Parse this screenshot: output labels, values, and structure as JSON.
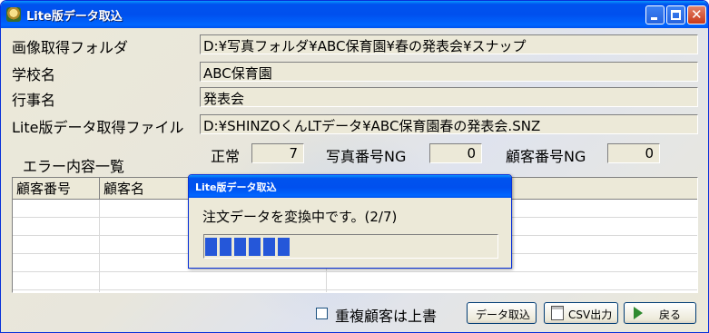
{
  "window": {
    "title": "Lite版データ取込",
    "controls": {
      "minimize": "minimize",
      "maximize": "maximize",
      "close": "✕"
    }
  },
  "form": {
    "image_folder": {
      "label": "画像取得フォルダ",
      "value": "D:¥写真フォルダ¥ABC保育園¥春の発表会¥スナップ"
    },
    "school": {
      "label": "学校名",
      "value": "ABC保育園"
    },
    "event": {
      "label": "行事名",
      "value": "発表会"
    },
    "lite_file": {
      "label": "Lite版データ取得ファイル",
      "value": "D:¥SHINZOくんLTデータ¥ABC保育園春の発表会.SNZ"
    }
  },
  "counts": {
    "normal": {
      "label": "正常",
      "value": "7"
    },
    "photo_ng": {
      "label": "写真番号NG",
      "value": "0"
    },
    "customer_ng": {
      "label": "顧客番号NG",
      "value": "0"
    }
  },
  "errors": {
    "title": "エラー内容一覧",
    "columns": [
      "顧客番号",
      "顧客名"
    ]
  },
  "footer": {
    "duplicate_checkbox": {
      "label": "重複顧客は上書",
      "checked": false
    },
    "import_button": "データ取込",
    "csv_button": "CSV出力",
    "back_button": "戻る"
  },
  "progress_dialog": {
    "title": "Lite版データ取込",
    "message": "注文データを変換中です。(2/7)",
    "progress_percent": 30
  },
  "colors": {
    "titlebar": "#0053ee",
    "progress": "#2557d9"
  }
}
